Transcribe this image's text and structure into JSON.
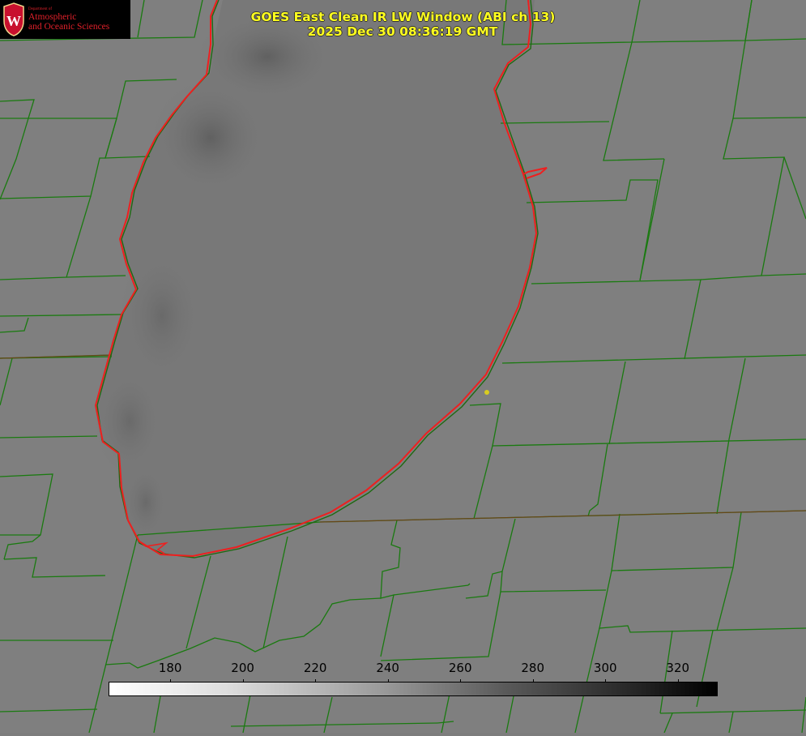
{
  "header": {
    "title_line1": "GOES East Clean IR LW Window (ABI ch 13)",
    "title_line2": "2025 Dec 30 08:36:19 GMT"
  },
  "logo": {
    "department": "Department of",
    "line1": "Atmospheric",
    "line2": "and Oceanic Sciences",
    "seal_letter": "W"
  },
  "colorbar": {
    "ticks": [
      "180",
      "200",
      "220",
      "240",
      "260",
      "280",
      "300",
      "320"
    ],
    "range": [
      163,
      331
    ],
    "colormap": "white-to-black grayscale"
  },
  "colors": {
    "background": "#7d7d7d",
    "county_lines": "#1a7a10",
    "coast_lines": "#ee1f1f",
    "title": "#ffff1e",
    "marker": "#d8cc20"
  }
}
